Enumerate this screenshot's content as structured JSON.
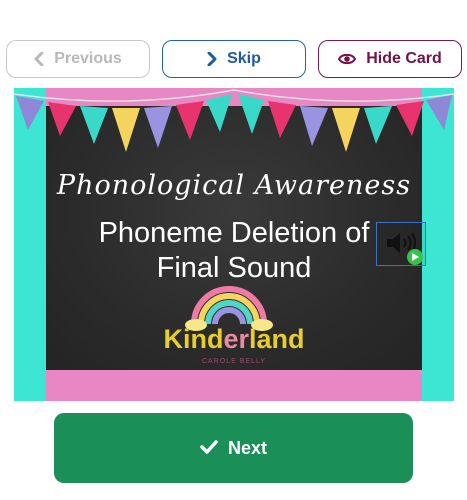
{
  "toolbar": {
    "previous_label": "Previous",
    "skip_label": "Skip",
    "hide_card_label": "Hide Card"
  },
  "card": {
    "script_title": "Phonological Awareness",
    "main_title_line1": "Phoneme Deletion of",
    "main_title_line2": "Final Sound",
    "brand_part1": "Kind",
    "brand_part2": "er",
    "brand_part3": "land",
    "byline": "CAROLE BELLY"
  },
  "next_label": "Next",
  "icons": {
    "previous": "chevron-left-icon",
    "skip": "chevron-right-icon",
    "hide_card": "eye-icon",
    "audio": "speaker-icon",
    "play": "play-icon",
    "next": "checkmark-icon"
  },
  "colors": {
    "skip_border": "#2563a8",
    "hide_border": "#7a1a4e",
    "next_bg": "#1a8f58",
    "teal": "#3ce6d2",
    "pink": "#e986c4",
    "chalkboard": "#2b2b2b"
  }
}
